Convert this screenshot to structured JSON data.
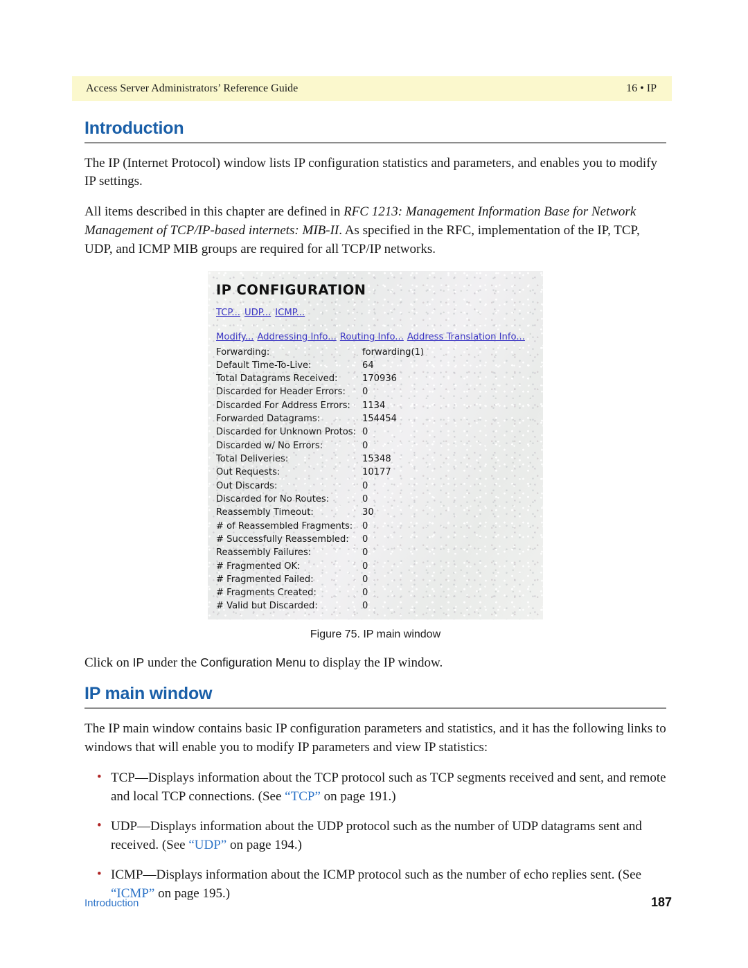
{
  "header": {
    "document_title": "Access Server Administrators’ Reference Guide",
    "chapter_label": "16 • IP"
  },
  "sections": {
    "introduction": {
      "heading": "Introduction",
      "paragraph_1": "The IP (Internet Protocol) window lists IP configuration statistics and parameters, and enables you to modify IP settings.",
      "paragraph_2_part1": "All items described in this chapter are defined in ",
      "paragraph_2_italic1": "RFC 1213: Management Information Base for Network Management of TCP/IP-based internets: MIB-II",
      "paragraph_2_part2": ". As specified in the RFC, implementation of the IP, TCP, UDP, and ICMP MIB groups are required for all TCP/IP networks."
    },
    "ip_main_window": {
      "heading": "IP main window",
      "intro_paragraph": "The IP main window contains basic IP configuration parameters and statistics, and it has the following links to windows that will enable you to modify IP parameters and view IP statistics:",
      "bullets": [
        {
          "text_before": "TCP—Displays information about the TCP protocol such as TCP segments received and sent, and remote and local TCP connections. (See ",
          "link": "“TCP”",
          "text_after": " on page 191.)"
        },
        {
          "text_before": "UDP—Displays information about the UDP protocol such as the number of UDP datagrams sent and received. (See ",
          "link": "“UDP”",
          "text_after": " on page 194.)"
        },
        {
          "text_before": "ICMP—Displays information about the ICMP protocol such as the number of echo replies sent. (See ",
          "link": "“ICMP”",
          "text_after": " on page 195.)"
        }
      ]
    }
  },
  "figure": {
    "caption": "Figure 75. IP main window",
    "instruction_before": "Click on ",
    "instruction_term1": "IP",
    "instruction_middle": " under the ",
    "instruction_term2": "Configuration Menu",
    "instruction_after": " to display the IP window.",
    "window": {
      "title": "IP CONFIGURATION",
      "protocol_links": [
        "TCP...",
        "UDP...",
        "ICMP..."
      ],
      "action_links": [
        "Modify...",
        "Addressing Info...",
        "Routing Info...",
        "Address Translation Info..."
      ],
      "stats": [
        {
          "label": "Forwarding:",
          "value": "forwarding(1)"
        },
        {
          "label": "Default Time-To-Live:",
          "value": "64"
        },
        {
          "label": "Total Datagrams Received:",
          "value": "170936"
        },
        {
          "label": "Discarded for Header Errors:",
          "value": "0"
        },
        {
          "label": "Discarded For Address Errors:",
          "value": "1134"
        },
        {
          "label": "Forwarded Datagrams:",
          "value": "154454"
        },
        {
          "label": "Discarded for Unknown Protos:",
          "value": "0"
        },
        {
          "label": "Discarded w/ No Errors:",
          "value": "0"
        },
        {
          "label": "Total Deliveries:",
          "value": "15348"
        },
        {
          "label": "Out Requests:",
          "value": "10177"
        },
        {
          "label": "Out Discards:",
          "value": "0"
        },
        {
          "label": "Discarded for No Routes:",
          "value": "0"
        },
        {
          "label": "Reassembly Timeout:",
          "value": "30"
        },
        {
          "label": "# of Reassembled Fragments:",
          "value": "0"
        },
        {
          "label": "# Successfully Reassembled:",
          "value": "0"
        },
        {
          "label": "Reassembly Failures:",
          "value": "0"
        },
        {
          "label": "# Fragmented OK:",
          "value": "0"
        },
        {
          "label": "# Fragmented Failed:",
          "value": "0"
        },
        {
          "label": "# Fragments Created:",
          "value": "0"
        },
        {
          "label": "# Valid but Discarded:",
          "value": "0"
        }
      ]
    }
  },
  "footer": {
    "section_name": "Introduction",
    "page_number": "187"
  },
  "colors": {
    "header_band": "#fbf8cd",
    "header_text": "#16467e",
    "heading_blue": "#1a5fa8",
    "xref_blue": "#2e74c8",
    "window_link": "#3b36c4",
    "bullet_red": "#b02525"
  }
}
